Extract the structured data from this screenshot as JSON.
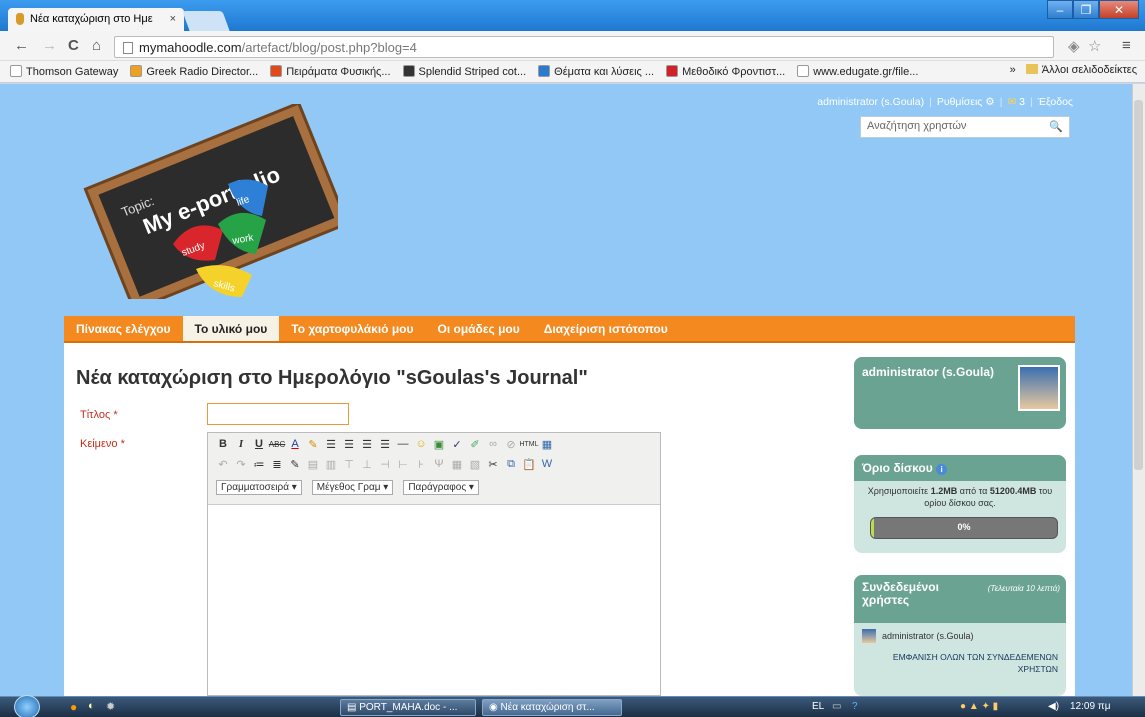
{
  "browser": {
    "tab_title": "Νέα καταχώριση στο Ημε",
    "tab_close": "×",
    "url_host": "mymahoodle.com",
    "url_path": "/artefact/blog/post.php?blog=4",
    "bookmarks": [
      {
        "label": "Thomson Gateway",
        "color": "#ffffff"
      },
      {
        "label": "Greek Radio Director...",
        "color": "#f0a020"
      },
      {
        "label": "Πειράματα Φυσικής...",
        "color": "#e04a1a"
      },
      {
        "label": "Splendid Striped cot...",
        "color": "#333333"
      },
      {
        "label": "Θέματα και λύσεις ...",
        "color": "#2a7ad0"
      },
      {
        "label": "Μεθοδικό Φροντιστ...",
        "color": "#d0202a"
      },
      {
        "label": "www.edugate.gr/file...",
        "color": "#ffffff"
      }
    ],
    "bookmarks_more": "»",
    "other_bookmarks": "Άλλοι σελιδοδείκτες"
  },
  "usernav": {
    "user": "administrator (s.Goula)",
    "settings": "Ρυθμίσεις",
    "inbox_count": "3",
    "logout": "Έξοδος"
  },
  "search": {
    "placeholder": "Αναζήτηση χρηστών"
  },
  "logo": {
    "topic": "Topic:",
    "title": "My e-portfolio",
    "pieces": [
      "study",
      "life",
      "work",
      "skills"
    ]
  },
  "nav": {
    "items": [
      "Πίνακας ελέγχου",
      "Το υλικό μου",
      "Το χαρτοφυλάκιό μου",
      "Οι ομάδες μου",
      "Διαχείριση ιστότοπου"
    ],
    "active_index": 1
  },
  "main": {
    "title": "Νέα καταχώριση στο Ημερολόγιο \"sGoulas's Journal\"",
    "title_label": "Τίτλος",
    "body_label": "Κείμενο",
    "required_mark": "*",
    "editor": {
      "font_select": "Γραμματοσειρά",
      "size_select": "Μέγεθος Γραμ",
      "format_select": "Παράγραφος"
    }
  },
  "sidebar": {
    "profile_name": "administrator (s.Goula)",
    "quota": {
      "title": "Όριο δίσκου",
      "used_prefix": "Χρησιμοποιείτε",
      "used": "1.2MB",
      "mid": "από τα",
      "total": "51200.4MB",
      "suffix": "του ορίου δίσκου σας.",
      "percent_label": "0%",
      "percent_value": 0
    },
    "online": {
      "title": "Συνδεδεμένοι χρήστες",
      "subtitle": "(Τελευταία 10 λεπτά)",
      "user": "administrator (s.Goula)",
      "show_all": "ΕΜΦΑΝΙΣΗ ΟΛΩΝ ΤΩΝ ΣΥΝΔΕΔΕΜΕΝΩΝ ΧΡΗΣΤΩΝ"
    }
  },
  "taskbar": {
    "items": [
      "PORT_MAHA.doc - ...",
      "Νέα καταχώριση στ..."
    ],
    "lang": "EL",
    "clock": "12:09 πμ"
  },
  "colors": {
    "page_bg": "#92c8f5",
    "nav_orange": "#f4891f",
    "sidebar_teal": "#6aa391",
    "required_red": "#c62b1a"
  }
}
